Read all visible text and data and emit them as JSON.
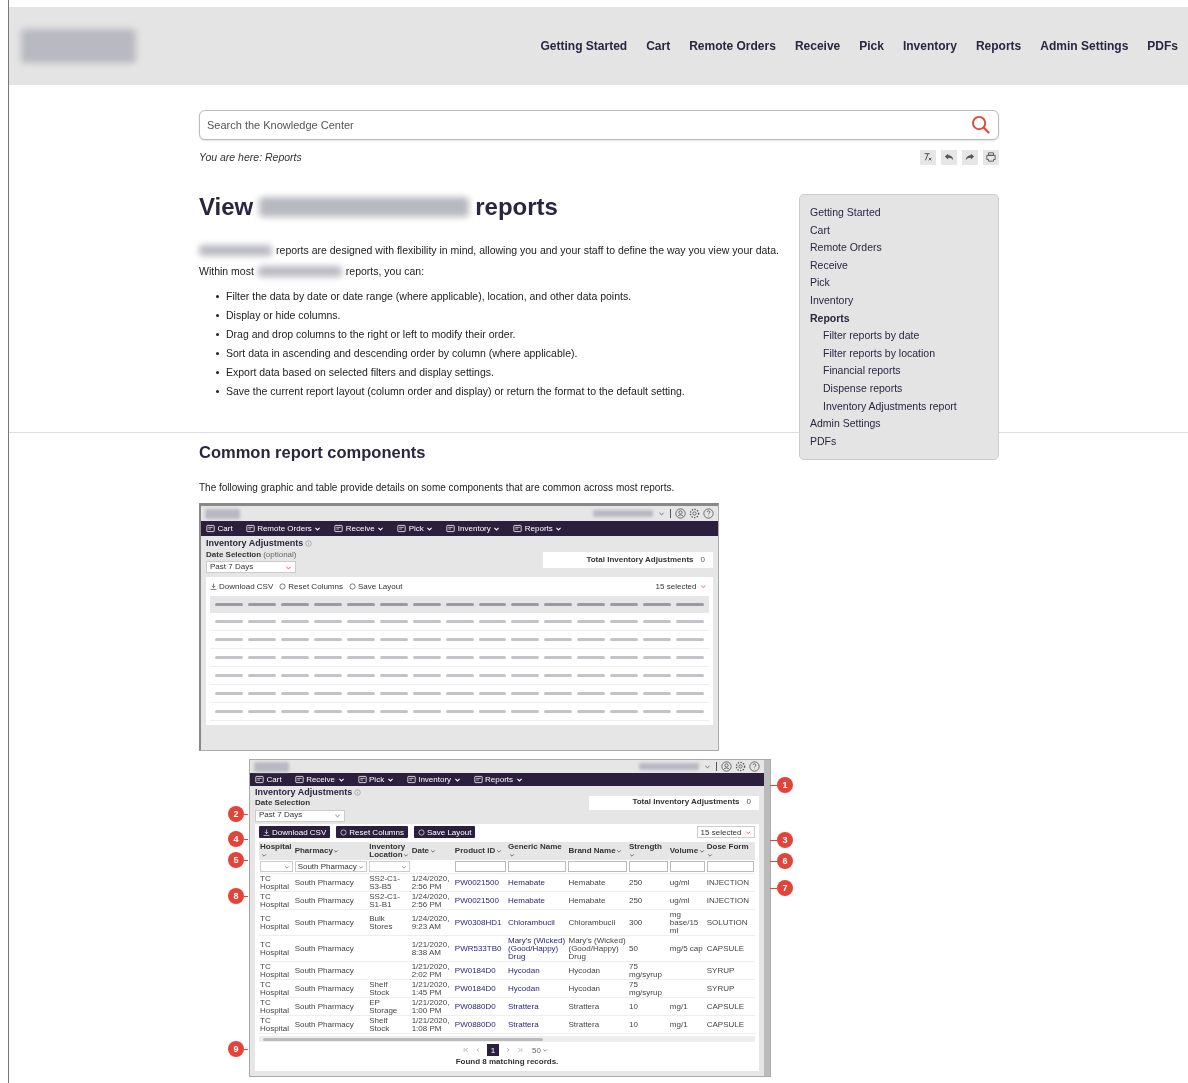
{
  "header": {
    "nav": [
      "Getting Started",
      "Cart",
      "Remote Orders",
      "Receive",
      "Pick",
      "Inventory",
      "Reports",
      "Admin Settings",
      "PDFs"
    ]
  },
  "search": {
    "placeholder": "Search the Knowledge Center"
  },
  "breadcrumb": "You are here: Reports",
  "title": {
    "before": "View",
    "after": "reports"
  },
  "intro": "reports are designed with flexibility in mind, allowing you and your staff to define the way you view your data.",
  "intro2": {
    "before": "Within most",
    "after": "reports, you can:"
  },
  "bullets": [
    "Filter the data by date or date range (where applicable), location, and other data points.",
    "Display or hide columns.",
    "Drag and drop columns to the right or left to modify their order.",
    "Sort data in ascending and descending order by column (where applicable).",
    "Export data based on selected filters and display settings.",
    "Save the current report layout (column order and display) or return the format to the default setting."
  ],
  "sidebar": {
    "items": [
      {
        "label": "Getting Started",
        "selected": false
      },
      {
        "label": "Cart",
        "selected": false
      },
      {
        "label": "Remote Orders",
        "selected": false
      },
      {
        "label": "Receive",
        "selected": false
      },
      {
        "label": "Pick",
        "selected": false
      },
      {
        "label": "Inventory",
        "selected": false
      },
      {
        "label": "Reports",
        "selected": true,
        "children": [
          {
            "label": "Filter reports by date",
            "selected": false
          },
          {
            "label": "Filter reports by location",
            "selected": false
          },
          {
            "label": "Financial reports",
            "selected": false
          },
          {
            "label": "Dispense reports",
            "selected": false
          },
          {
            "label": "Inventory Adjustments report",
            "selected": false
          }
        ]
      },
      {
        "label": "Admin Settings",
        "selected": false
      },
      {
        "label": "PDFs",
        "selected": false
      }
    ]
  },
  "section": {
    "title": "Common report components",
    "text": "The following graphic and table provide details on some components that are common across most reports."
  },
  "screenshots": [
    {
      "nav": [
        {
          "label": "Cart",
          "dropdown": false
        },
        {
          "label": "Remote Orders",
          "dropdown": true
        },
        {
          "label": "Receive",
          "dropdown": true
        },
        {
          "label": "Pick",
          "dropdown": true
        },
        {
          "label": "Inventory",
          "dropdown": true
        },
        {
          "label": "Reports",
          "dropdown": true
        }
      ],
      "title": "Inventory Adjustments",
      "date_label": "Date Selection",
      "date_hint": "(optional)",
      "date_value": "Past 7 Days",
      "total_label": "Total Inventory Adjustments",
      "total_value": "0",
      "toolbar": {
        "kind": "links",
        "actions": [
          "Download CSV",
          "Reset Columns",
          "Save Layout"
        ]
      },
      "columns_selected": "15 selected",
      "table": {
        "kind": "blurred"
      }
    },
    {
      "nav": [
        {
          "label": "Cart",
          "dropdown": false
        },
        {
          "label": "Receive",
          "dropdown": true
        },
        {
          "label": "Pick",
          "dropdown": true
        },
        {
          "label": "Inventory",
          "dropdown": true
        },
        {
          "label": "Reports",
          "dropdown": true
        }
      ],
      "title": "Inventory Adjustments",
      "date_label": "Date Selection",
      "date_value": "Past 7 Days",
      "total_label": "Total Inventory Adjustments",
      "total_value": "0",
      "toolbar": {
        "kind": "buttons",
        "actions": [
          "Download CSV",
          "Reset Columns",
          "Save Layout"
        ]
      },
      "columns_selected": "15 selected",
      "table": {
        "kind": "readable",
        "columns": [
          "Hospital",
          "Pharmacy",
          "Inventory Location",
          "Date",
          "Product ID",
          "Generic Name",
          "Brand Name",
          "Strength",
          "Volume",
          "Dose Form"
        ],
        "filters": [
          {
            "kind": "select"
          },
          {
            "kind": "select",
            "value": "South Pharmacy"
          },
          {
            "kind": "select"
          },
          {
            "kind": "none"
          },
          {
            "kind": "input"
          },
          {
            "kind": "input"
          },
          {
            "kind": "input"
          },
          {
            "kind": "input"
          },
          {
            "kind": "input"
          },
          {
            "kind": "input"
          }
        ],
        "rows": [
          [
            "TC Hospital",
            "South Pharmacy",
            "SS2-C1-S3-B5",
            "1/24/2020, 2:56 PM",
            "PW0021500",
            "Hemabate",
            "Hemabate",
            "250",
            "ug/ml",
            "INJECTION"
          ],
          [
            "TC Hospital",
            "South Pharmacy",
            "SS2-C1-S1-B1",
            "1/24/2020, 2:56 PM",
            "PW0021500",
            "Hemabate",
            "Hemabate",
            "250",
            "ug/ml",
            "INJECTION"
          ],
          [
            "TC Hospital",
            "South Pharmacy",
            "Bulk Stores",
            "1/24/2020, 9:23 AM",
            "PW0308HD1",
            "Chlorambucil",
            "Chlorambucil",
            "300",
            "mg base/15 ml",
            "SOLUTION"
          ],
          [
            "TC Hospital",
            "South Pharmacy",
            null,
            "1/21/2020, 8:38 AM",
            "PWR533TB0",
            "Mary's (Wicked) (Good/Happy) Drug",
            "Mary's (Wicked) (Good/Happy) Drug",
            "50",
            "mg/5 cap",
            "CAPSULE"
          ],
          [
            "TC Hospital",
            "South Pharmacy",
            null,
            "1/21/2020, 2:02 PM",
            "PW0184D0",
            "Hycodan",
            "Hycodan",
            "75 mg/syrup",
            null,
            "SYRUP"
          ],
          [
            "TC Hospital",
            "South Pharmacy",
            "Shelf Stock",
            "1/21/2020, 1:45 PM",
            "PW0184D0",
            "Hycodan",
            "Hycodan",
            "75 mg/syrup",
            null,
            "SYRUP"
          ],
          [
            "TC Hospital",
            "South Pharmacy",
            "EP Storage",
            "1/21/2020, 1:00 PM",
            "PW0880D0",
            "Strattera",
            "Strattera",
            "10",
            "mg/1",
            "CAPSULE"
          ],
          [
            "TC Hospital",
            "South Pharmacy",
            "Shelf Stock",
            "1/21/2020, 1:08 PM",
            "PW0880D0",
            "Strattera",
            "Strattera",
            "10",
            "mg/1",
            "CAPSULE"
          ]
        ]
      },
      "pager": {
        "pages": [
          {
            "label": "1",
            "selected": true
          }
        ],
        "per_page": "50",
        "found": "Found 8 matching records."
      },
      "callouts": [
        "1",
        "2",
        "4",
        "3",
        "5",
        "6",
        "7",
        "8",
        "9"
      ]
    }
  ]
}
